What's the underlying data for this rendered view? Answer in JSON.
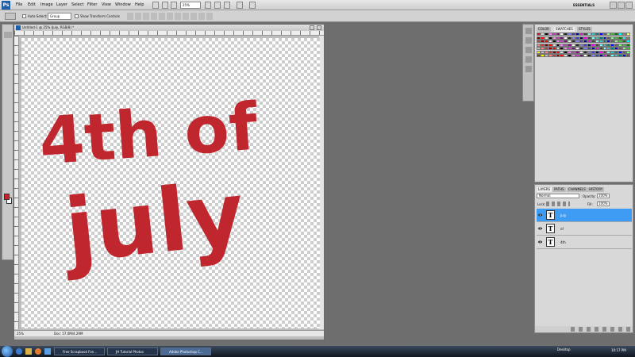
{
  "menubar": {
    "logo": "Ps",
    "items": [
      "File",
      "Edit",
      "Image",
      "Layer",
      "Select",
      "Filter",
      "View",
      "Window",
      "Help"
    ],
    "zoom": "25%",
    "workspace": "ESSENTIALS"
  },
  "options": {
    "auto_select_label": "Auto-Select:",
    "group_value": "Group",
    "transform_label": "Show Transform Controls"
  },
  "document": {
    "title": "Untitled-1 @ 25% (July, RGB/8) *",
    "art_line1": "4th of",
    "art_line2": "july",
    "status_zoom": "25%",
    "status_doc": "Doc: 57.0M/4.29M"
  },
  "swatches": {
    "tabs": [
      "COLOR",
      "SWATCHES",
      "STYLES"
    ],
    "active_tab": "SWATCHES"
  },
  "layers": {
    "tabs": [
      "LAYERS",
      "PATHS",
      "CHANNELS",
      "HISTORY"
    ],
    "blend_mode": "Normal",
    "opacity_label": "Opacity:",
    "opacity_value": "100%",
    "lock_label": "Lock:",
    "fill_label": "Fill:",
    "fill_value": "100%",
    "items": [
      {
        "name": "July",
        "selected": true
      },
      {
        "name": "of",
        "selected": false
      },
      {
        "name": "4th",
        "selected": false
      }
    ],
    "thumb_glyph": "T"
  },
  "taskbar": {
    "tasks": [
      "Free Scrapbook Fon...",
      "JH Tutorial Photos",
      "Adobe Photoshop C..."
    ],
    "tray": "Desktop",
    "clock": "10:17 PM"
  },
  "colors": {
    "art_red": "#c0262e",
    "selection_blue": "#3f9cf4"
  }
}
